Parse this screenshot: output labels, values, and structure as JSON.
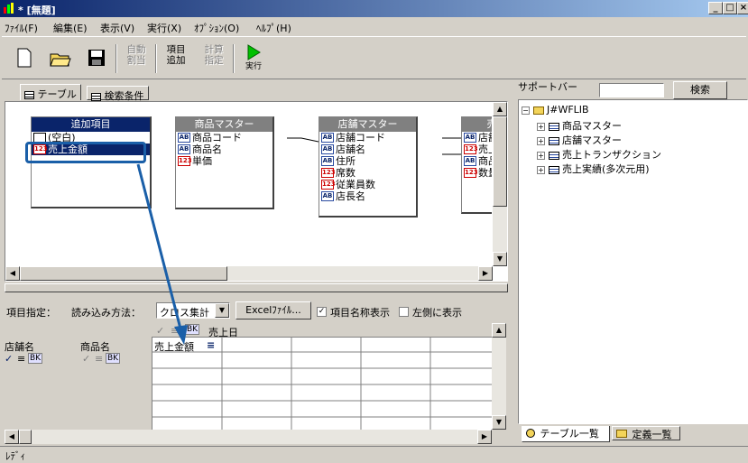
{
  "window": {
    "title": "* [無題]"
  },
  "menu": [
    {
      "label": "ﾌｧｲﾙ(F)"
    },
    {
      "label": "編集(E)"
    },
    {
      "label": "表示(V)"
    },
    {
      "label": "実行(X)"
    },
    {
      "label": "ｵﾌﾟｼｮﾝ(O)"
    },
    {
      "label": "ﾍﾙﾌﾟ(H)"
    }
  ],
  "toolbar": {
    "auto_assign": "自動\n割当",
    "add_item": "項目\n追加",
    "calc_spec": "計算\n指定",
    "run": "実行"
  },
  "tabs": {
    "table": "テーブル",
    "search": "検索条件"
  },
  "tables": {
    "added": {
      "title": "追加項目",
      "fields": [
        "(空白)",
        "売上金額"
      ]
    },
    "product": {
      "title": "商品マスター",
      "fields": [
        "商品コード",
        "商品名",
        "単価"
      ]
    },
    "store": {
      "title": "店舗マスター",
      "fields": [
        "店舗コード",
        "店舗名",
        "住所",
        "席数",
        "従業員数",
        "店長名"
      ]
    },
    "sales": {
      "title": "売上",
      "fields": [
        "店舗",
        "売上",
        "商品",
        "数量"
      ]
    }
  },
  "spec": {
    "label": "項目指定：",
    "read_method_label": "読み込み方法：",
    "read_method_value": "クロス集計",
    "excel_button": "Excelﾌｧｲﾙ...",
    "show_item_name": "項目名称表示",
    "show_left": "左側に表示",
    "col_header": "売上日",
    "bk": "BK",
    "row_headers": [
      "店舗名",
      "商品名"
    ],
    "cell_value": "売上金額"
  },
  "support": {
    "label": "サポートバー",
    "search_button": "検索",
    "tree_root": "J#WFLIB",
    "tree_items": [
      "商品マスター",
      "店舗マスター",
      "売上トランザクション",
      "売上実績(多次元用)"
    ],
    "tab_tables": "テーブル一覧",
    "tab_defs": "定義一覧"
  },
  "status": {
    "text": "ﾚﾃﾞｨ"
  }
}
